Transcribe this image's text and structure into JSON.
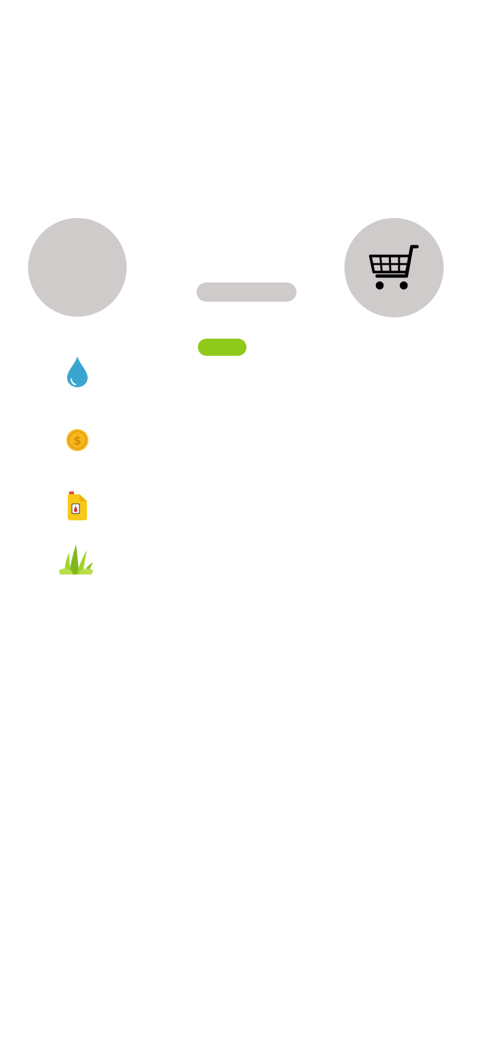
{
  "profile": {
    "avatar_icon": "avatar-placeholder",
    "name_text": "",
    "level_text": ""
  },
  "cart": {
    "icon": "shopping-cart-icon"
  },
  "resources": [
    {
      "name": "water",
      "icon": "water-drop-icon",
      "color": "#3aa6cf"
    },
    {
      "name": "coins",
      "icon": "coin-icon",
      "color": "#f5b81e"
    },
    {
      "name": "oil",
      "icon": "oil-canister-icon",
      "color": "#f8c81a"
    },
    {
      "name": "grass",
      "icon": "grass-icon",
      "color": "#8cc420"
    }
  ],
  "colors": {
    "placeholder_gray": "#cfcbcb",
    "level_green": "#8fc91a",
    "background": "#ffffff"
  }
}
